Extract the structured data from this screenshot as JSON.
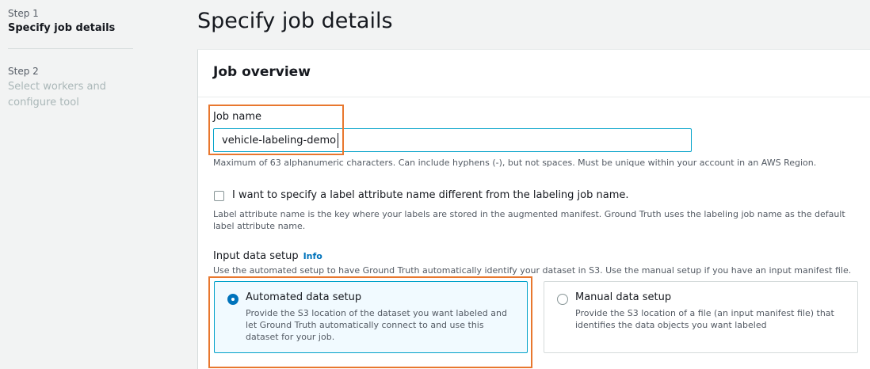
{
  "sidebar": {
    "steps": [
      {
        "number": "Step 1",
        "title": "Specify job details"
      },
      {
        "number": "Step 2",
        "title_line1": "Select workers and",
        "title_line2": "configure tool"
      }
    ]
  },
  "page": {
    "title": "Specify job details"
  },
  "job_overview": {
    "title": "Job overview",
    "job_name": {
      "label": "Job name",
      "value": "vehicle-labeling-demo",
      "hint": "Maximum of 63 alphanumeric characters. Can include hyphens (-), but not spaces. Must be unique within your account in an AWS Region."
    },
    "label_attribute": {
      "checked": false,
      "label": "I want to specify a label attribute name different from the labeling job name.",
      "hint_line1": "Label attribute name is the key where your labels are stored in the augmented manifest. Ground Truth uses the labeling job name as the default",
      "hint_line2": "label attribute name."
    },
    "input_data_setup": {
      "label": "Input data setup",
      "info_link": "Info",
      "hint": "Use the automated setup to have Ground Truth automatically identify your dataset in S3. Use the manual setup if you have an input manifest file.",
      "options": [
        {
          "title": "Automated data setup",
          "desc_line1": "Provide the S3 location of the dataset you want labeled and",
          "desc_line2": "let Ground Truth automatically connect to and use this",
          "desc_line3": "dataset for your job.",
          "selected": true
        },
        {
          "title": "Manual data setup",
          "desc_line1": "Provide the S3 location of a file (an input manifest file) that",
          "desc_line2": "identifies the data objects you want labeled",
          "selected": false
        }
      ]
    }
  },
  "colors": {
    "accent": "#0073bb",
    "focus": "#00a1c9",
    "highlight": "#e8772e"
  }
}
